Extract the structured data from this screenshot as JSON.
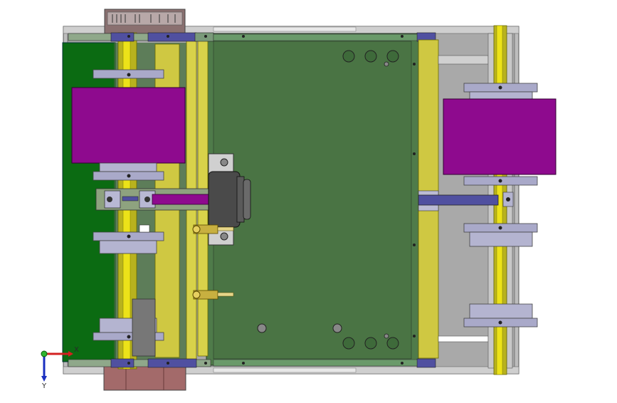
{
  "viewport": {
    "background": "#ffffff"
  },
  "triad": {
    "x_label": "X",
    "y_label": "Y",
    "x_color": "#d32020",
    "y_color": "#1a2fc0",
    "z_color": "#2fb52f"
  },
  "colors": {
    "frame_gray": "#b8b8b8",
    "dark_green_panel": "#0b6b12",
    "plate_green": "#4f7b4a",
    "roller_yellow": "#d8d24a",
    "shaft_yellow": "#e6dc16",
    "magenta_drum": "#8e0a8e",
    "disc_lavender": "#a9a9c9",
    "bracket_blue": "#5050a0",
    "maroon_box": "#a36a6a",
    "motor_dark": "#4a4a4a"
  }
}
